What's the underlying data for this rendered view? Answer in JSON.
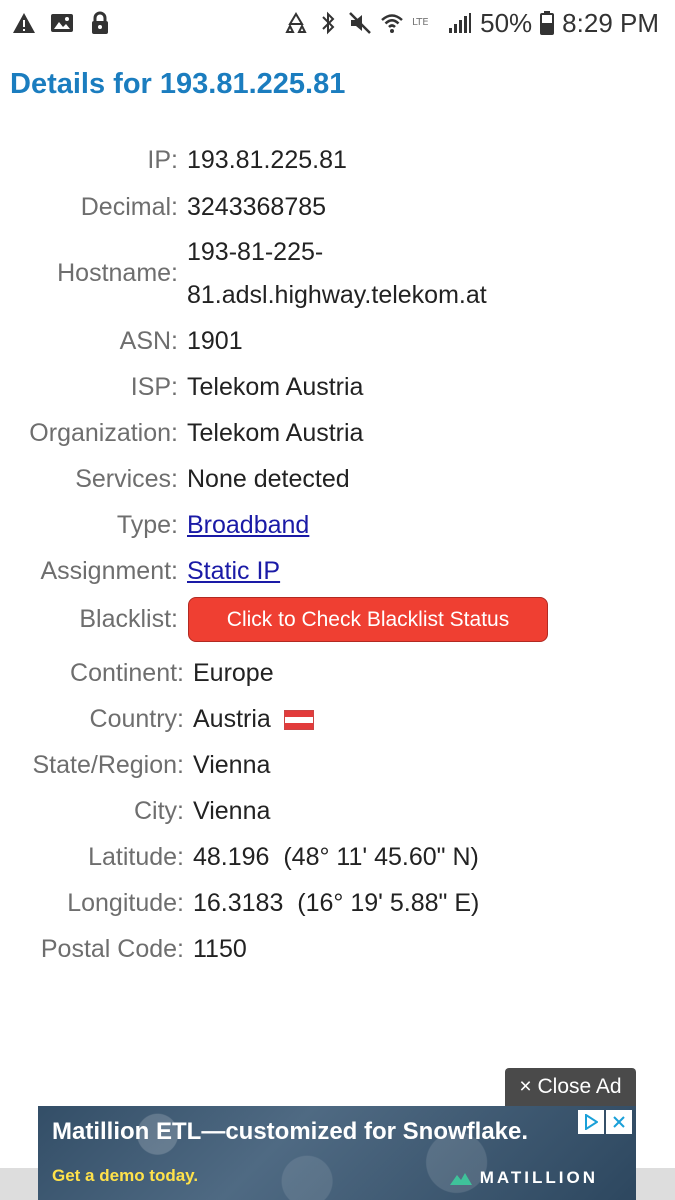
{
  "status_bar": {
    "battery": "50%",
    "time": "8:29 PM",
    "left_icons": [
      "warning-icon",
      "image-icon",
      "lock-icon"
    ],
    "right_icons": [
      "recycle-icon",
      "bluetooth-icon",
      "mute-icon",
      "wifi-icon",
      "lte-icon",
      "signal-icon",
      "battery-icon"
    ]
  },
  "title": "Details for 193.81.225.81",
  "details": {
    "ip": {
      "label": "IP:",
      "value": "193.81.225.81"
    },
    "decimal": {
      "label": "Decimal:",
      "value": "3243368785"
    },
    "hostname": {
      "label": "Hostname:",
      "value_line1": "193-81-225-",
      "value_line2": "81.adsl.highway.telekom.at"
    },
    "asn": {
      "label": "ASN:",
      "value": "1901"
    },
    "isp": {
      "label": "ISP:",
      "value": "Telekom Austria"
    },
    "organization": {
      "label": "Organization:",
      "value": "Telekom Austria"
    },
    "services": {
      "label": "Services:",
      "value": "None detected"
    },
    "type": {
      "label": "Type:",
      "value": "Broadband"
    },
    "assignment": {
      "label": "Assignment:",
      "value": "Static IP"
    },
    "blacklist": {
      "label": "Blacklist:",
      "button": "Click to Check Blacklist Status"
    },
    "continent": {
      "label": "Continent:",
      "value": "Europe"
    },
    "country": {
      "label": "Country:",
      "value": "Austria",
      "flag_icon": "austria-flag-icon"
    },
    "state_region": {
      "label": "State/Region:",
      "value": "Vienna"
    },
    "city": {
      "label": "City:",
      "value": "Vienna"
    },
    "latitude": {
      "label": "Latitude:",
      "value": "48.196  (48° 11' 45.60\" N)"
    },
    "longitude": {
      "label": "Longitude:",
      "value": "16.3183  (16° 19' 5.88\" E)"
    },
    "postal_code": {
      "label": "Postal Code:",
      "value": "1150"
    }
  },
  "ad": {
    "close_label": "× Close Ad",
    "headline": "Matillion ETL—customized for Snowflake.",
    "sub": "Get a demo today.",
    "brand": "MATILLION"
  },
  "colors": {
    "title": "#1b7dbf",
    "link": "#1a1aa6",
    "blacklist_button": "#ef3f32"
  }
}
